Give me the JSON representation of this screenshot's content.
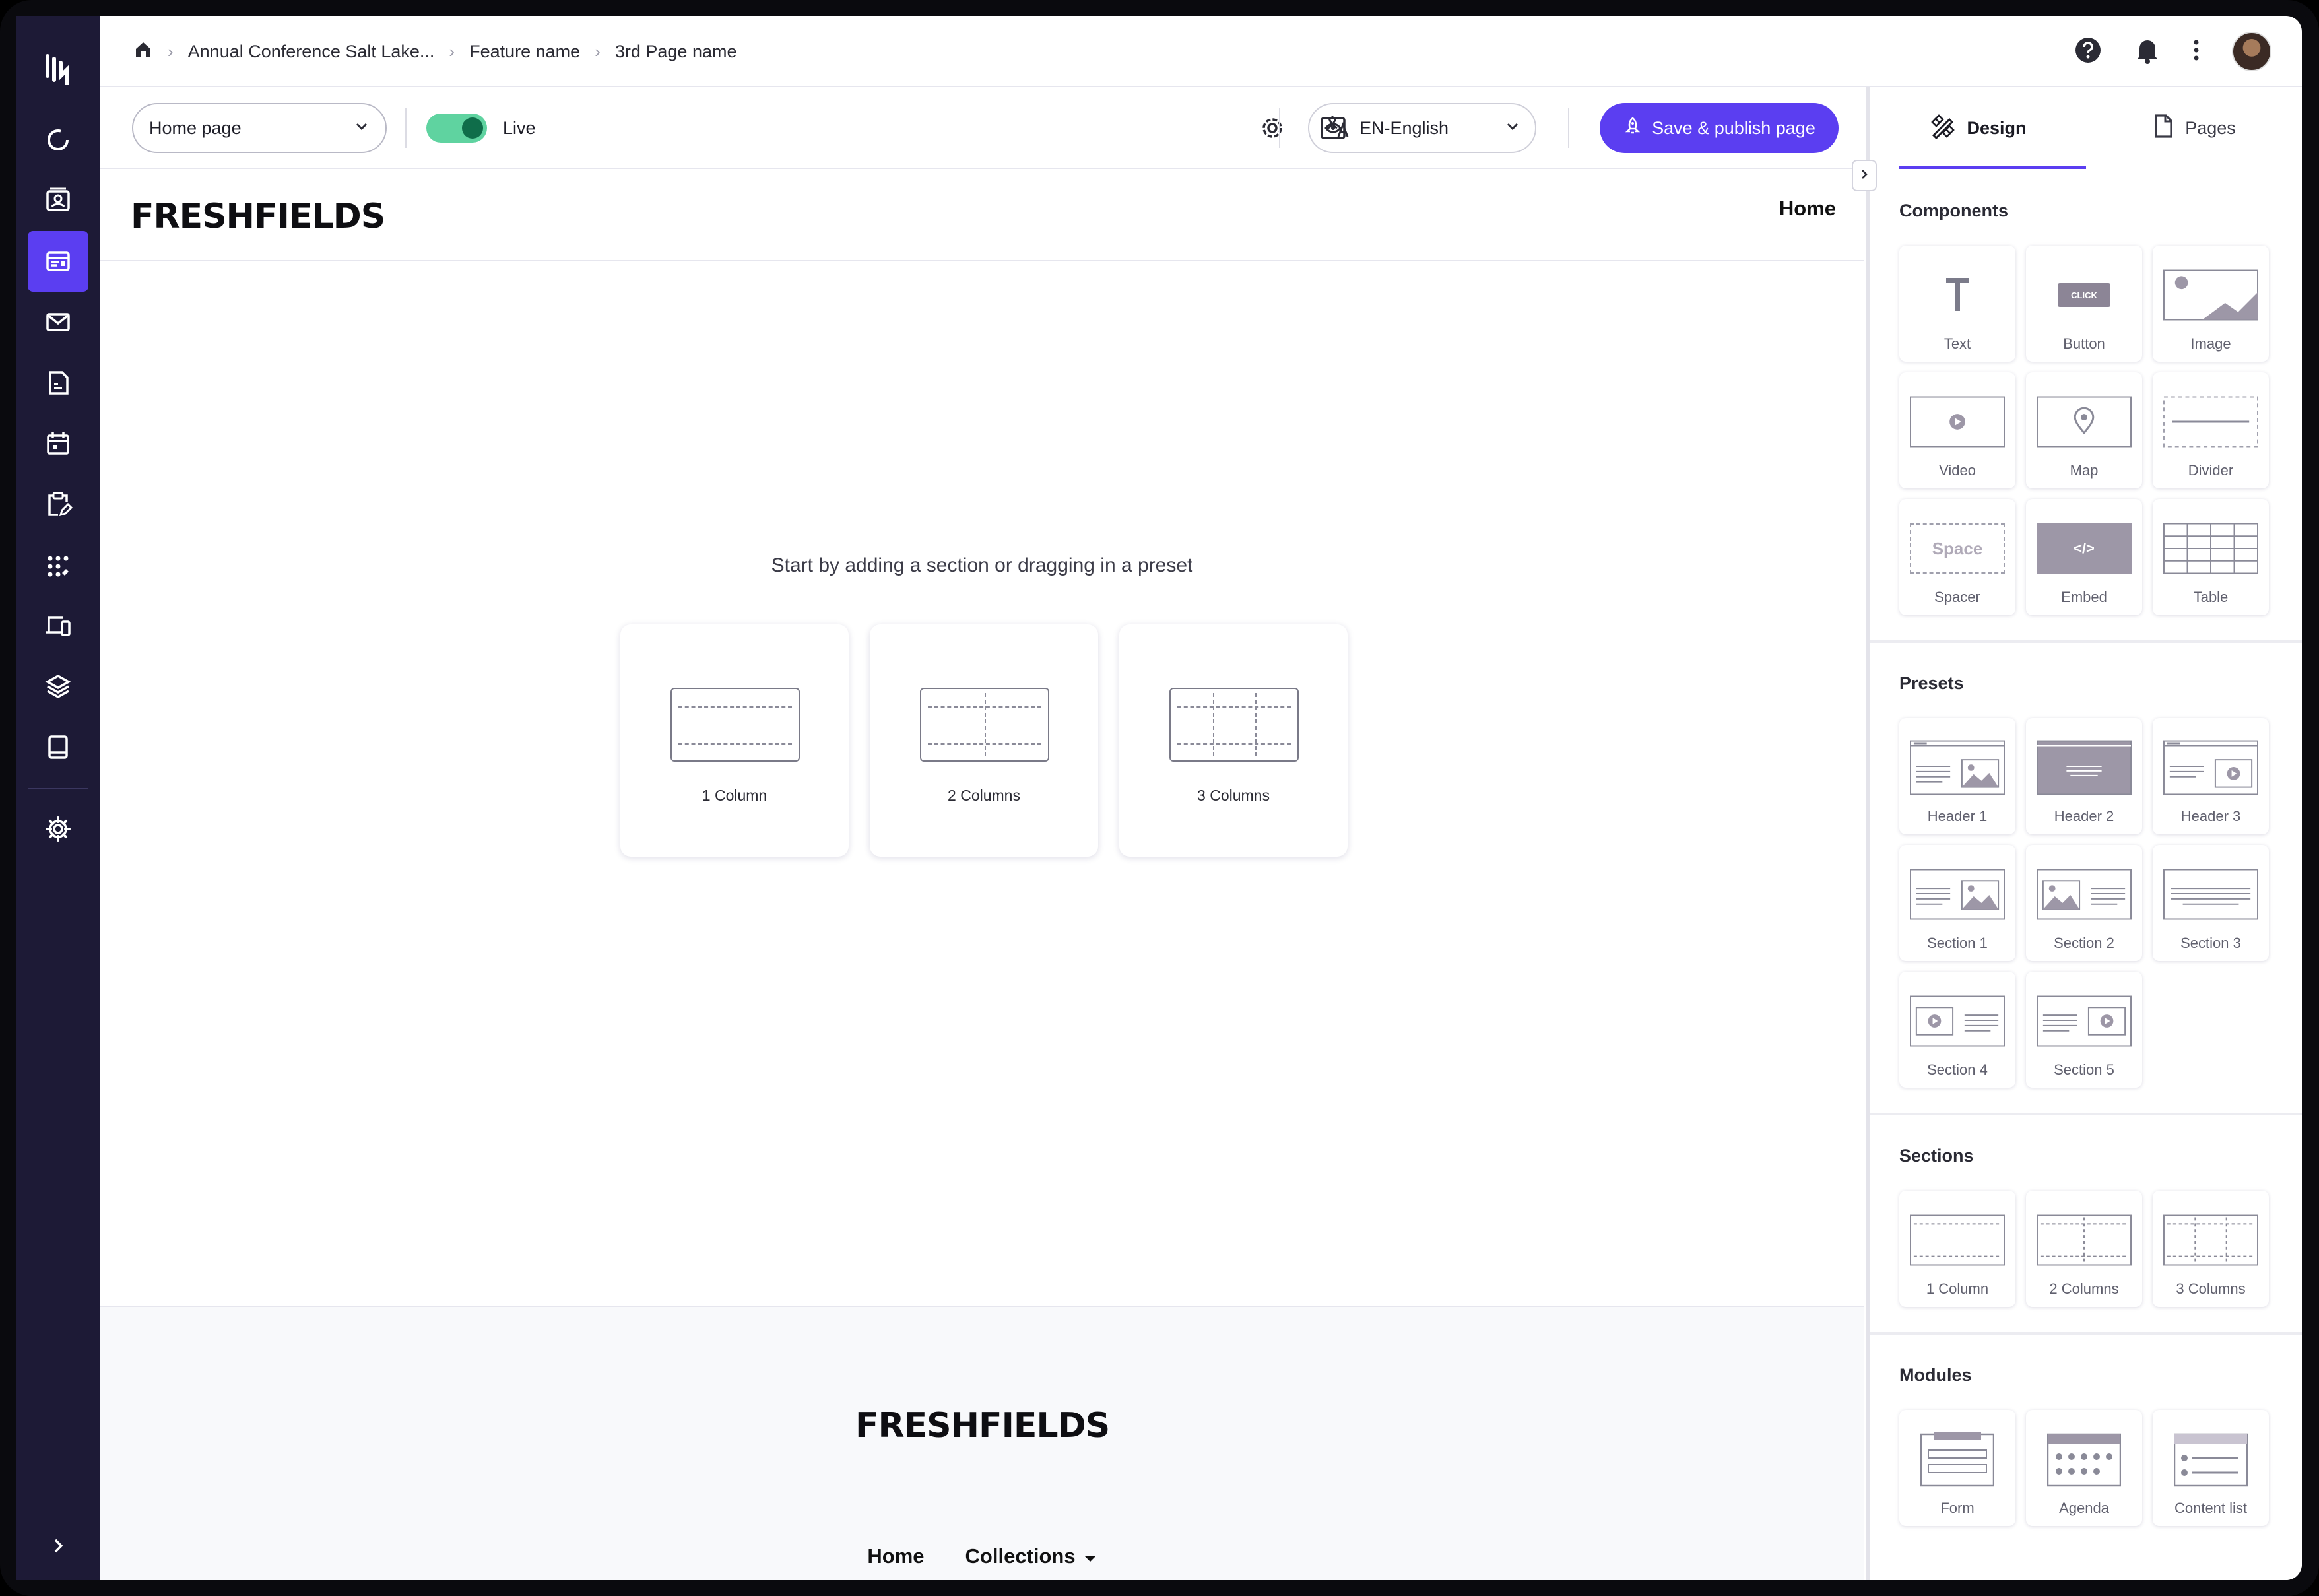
{
  "breadcrumb": [
    "Annual Conference Salt Lake...",
    "Feature name",
    "3rd Page name"
  ],
  "toolbar": {
    "page_select": "Home page",
    "live_label": "Live",
    "language": "EN-English",
    "publish_label": "Save & publish page"
  },
  "canvas": {
    "brand": "FRESHFIELDS",
    "nav_home": "Home",
    "empty_message": "Start by adding a section or dragging in a preset",
    "layouts": [
      "1 Column",
      "2 Columns",
      "3 Columns"
    ],
    "footer_brand": "FRESHFIELDS",
    "footer_nav": [
      "Home",
      "Collections"
    ]
  },
  "panel": {
    "tabs": [
      "Design",
      "Pages"
    ],
    "components_title": "Components",
    "components": [
      "Text",
      "Button",
      "Image",
      "Video",
      "Map",
      "Divider",
      "Spacer",
      "Embed",
      "Table"
    ],
    "button_art_text": "CLICK",
    "spacer_art_text": "Space",
    "embed_art_text": "</>",
    "presets_title": "Presets",
    "presets": [
      "Header 1",
      "Header 2",
      "Header 3",
      "Section 1",
      "Section 2",
      "Section 3",
      "Section 4",
      "Section 5"
    ],
    "sections_title": "Sections",
    "sections": [
      "1 Column",
      "2 Columns",
      "3 Columns"
    ],
    "modules_title": "Modules",
    "modules": [
      "Form",
      "Agenda",
      "Content list"
    ]
  },
  "colors": {
    "accent": "#5b3ef1",
    "sidebar": "#1d1a36",
    "toggle_on": "#5fd3a0"
  }
}
